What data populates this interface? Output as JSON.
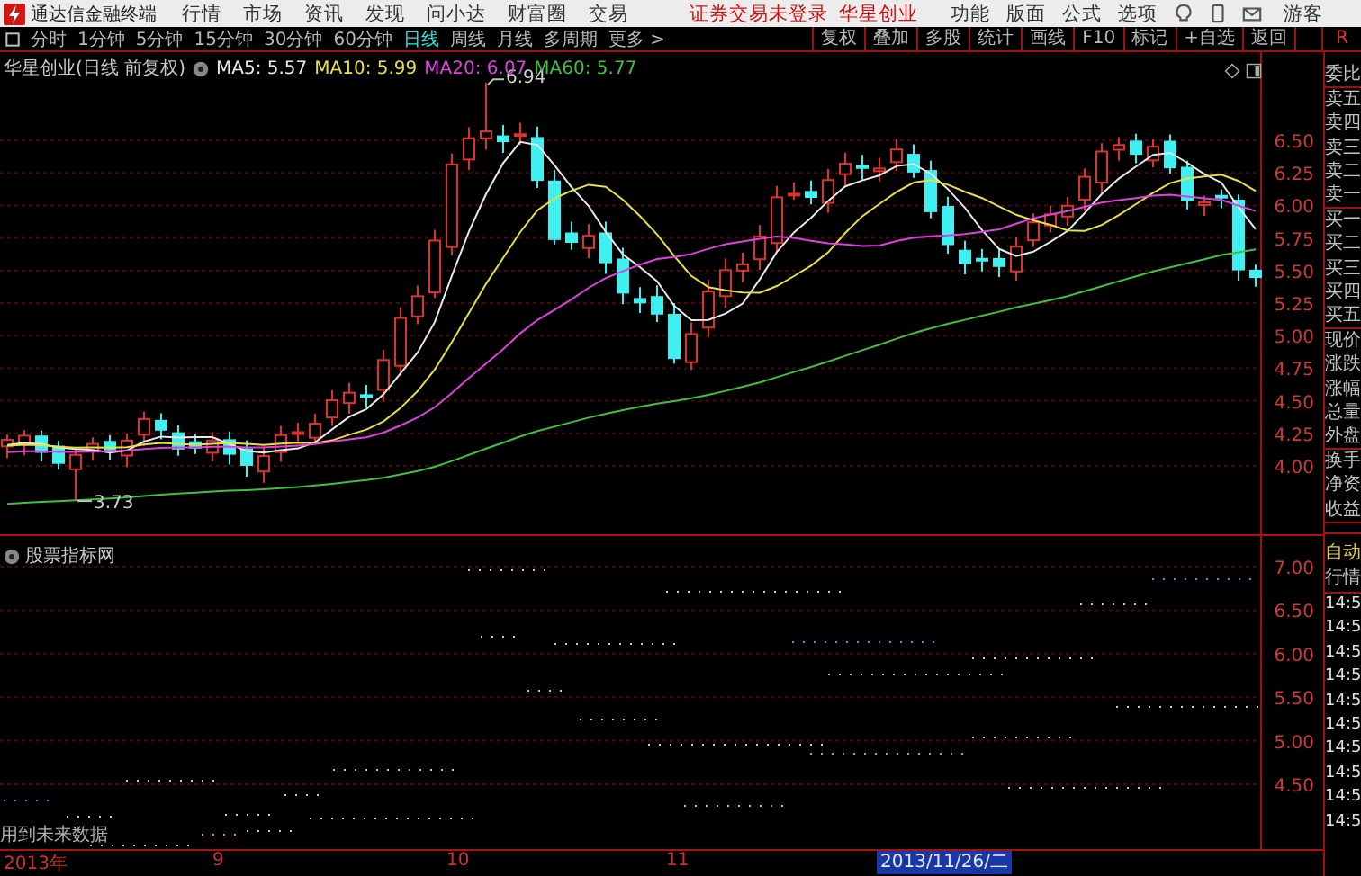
{
  "app_bar": {
    "title": "通达信金融终端",
    "menus": [
      "行情",
      "市场",
      "资讯",
      "发现",
      "问小达",
      "财富圈",
      "交易"
    ],
    "notice": "证券交易未登录",
    "stock": "华星创业",
    "right_menus": [
      "功能",
      "版面",
      "公式",
      "选项"
    ],
    "user": "游客"
  },
  "period_tabs": [
    {
      "label": "分时",
      "selected": false
    },
    {
      "label": "1分钟",
      "selected": false
    },
    {
      "label": "5分钟",
      "selected": false
    },
    {
      "label": "15分钟",
      "selected": false
    },
    {
      "label": "30分钟",
      "selected": false
    },
    {
      "label": "60分钟",
      "selected": false
    },
    {
      "label": "日线",
      "selected": true
    },
    {
      "label": "周线",
      "selected": false
    },
    {
      "label": "月线",
      "selected": false
    },
    {
      "label": "多周期",
      "selected": false
    }
  ],
  "more_button": "更多 >",
  "tools": [
    "复权",
    "叠加",
    "多股",
    "统计",
    "画线",
    "F10",
    "标记",
    "+自选",
    "返回"
  ],
  "side_tab": "R",
  "main_chart": {
    "title": "华星创业(日线 前复权)",
    "ma": [
      {
        "label": "MA5: 5.57",
        "color": "#e8e8e8"
      },
      {
        "label": "MA10: 5.99",
        "color": "#e8e040"
      },
      {
        "label": "MA20: 6.07",
        "color": "#e040e0"
      },
      {
        "label": "MA60: 5.77",
        "color": "#40c040"
      }
    ],
    "y_ticks": [
      "6.50",
      "6.25",
      "6.00",
      "5.75",
      "5.50",
      "5.25",
      "5.00",
      "4.75",
      "4.50",
      "4.25",
      "4.00"
    ],
    "high_label": "6.94",
    "low_label": "3.73"
  },
  "indicator": {
    "title": "股票指标网",
    "y_ticks": [
      "7.00",
      "6.50",
      "6.00",
      "5.50",
      "5.00",
      "4.50"
    ],
    "note": "用到未来数据"
  },
  "x_axis": {
    "labels": [
      "2013年",
      "9",
      "10",
      "11"
    ],
    "cursor_date": "2013/11/26/二"
  },
  "quote_panel": {
    "groups": [
      [
        "委比"
      ],
      [
        "卖五",
        "卖四",
        "卖三",
        "卖二",
        "卖一"
      ],
      [
        "买一",
        "买二",
        "买三",
        "买四",
        "买五"
      ],
      [
        "现价",
        "涨跌",
        "涨幅",
        "总量",
        "外盘"
      ],
      [
        "换手",
        "净资",
        "收益"
      ]
    ],
    "mode": "自动",
    "section": "行情",
    "times": [
      "14:5",
      "14:5",
      "14:5",
      "14:5",
      "14:5",
      "14:5",
      "14:5",
      "14:5",
      "14:5",
      "14:5"
    ]
  }
}
